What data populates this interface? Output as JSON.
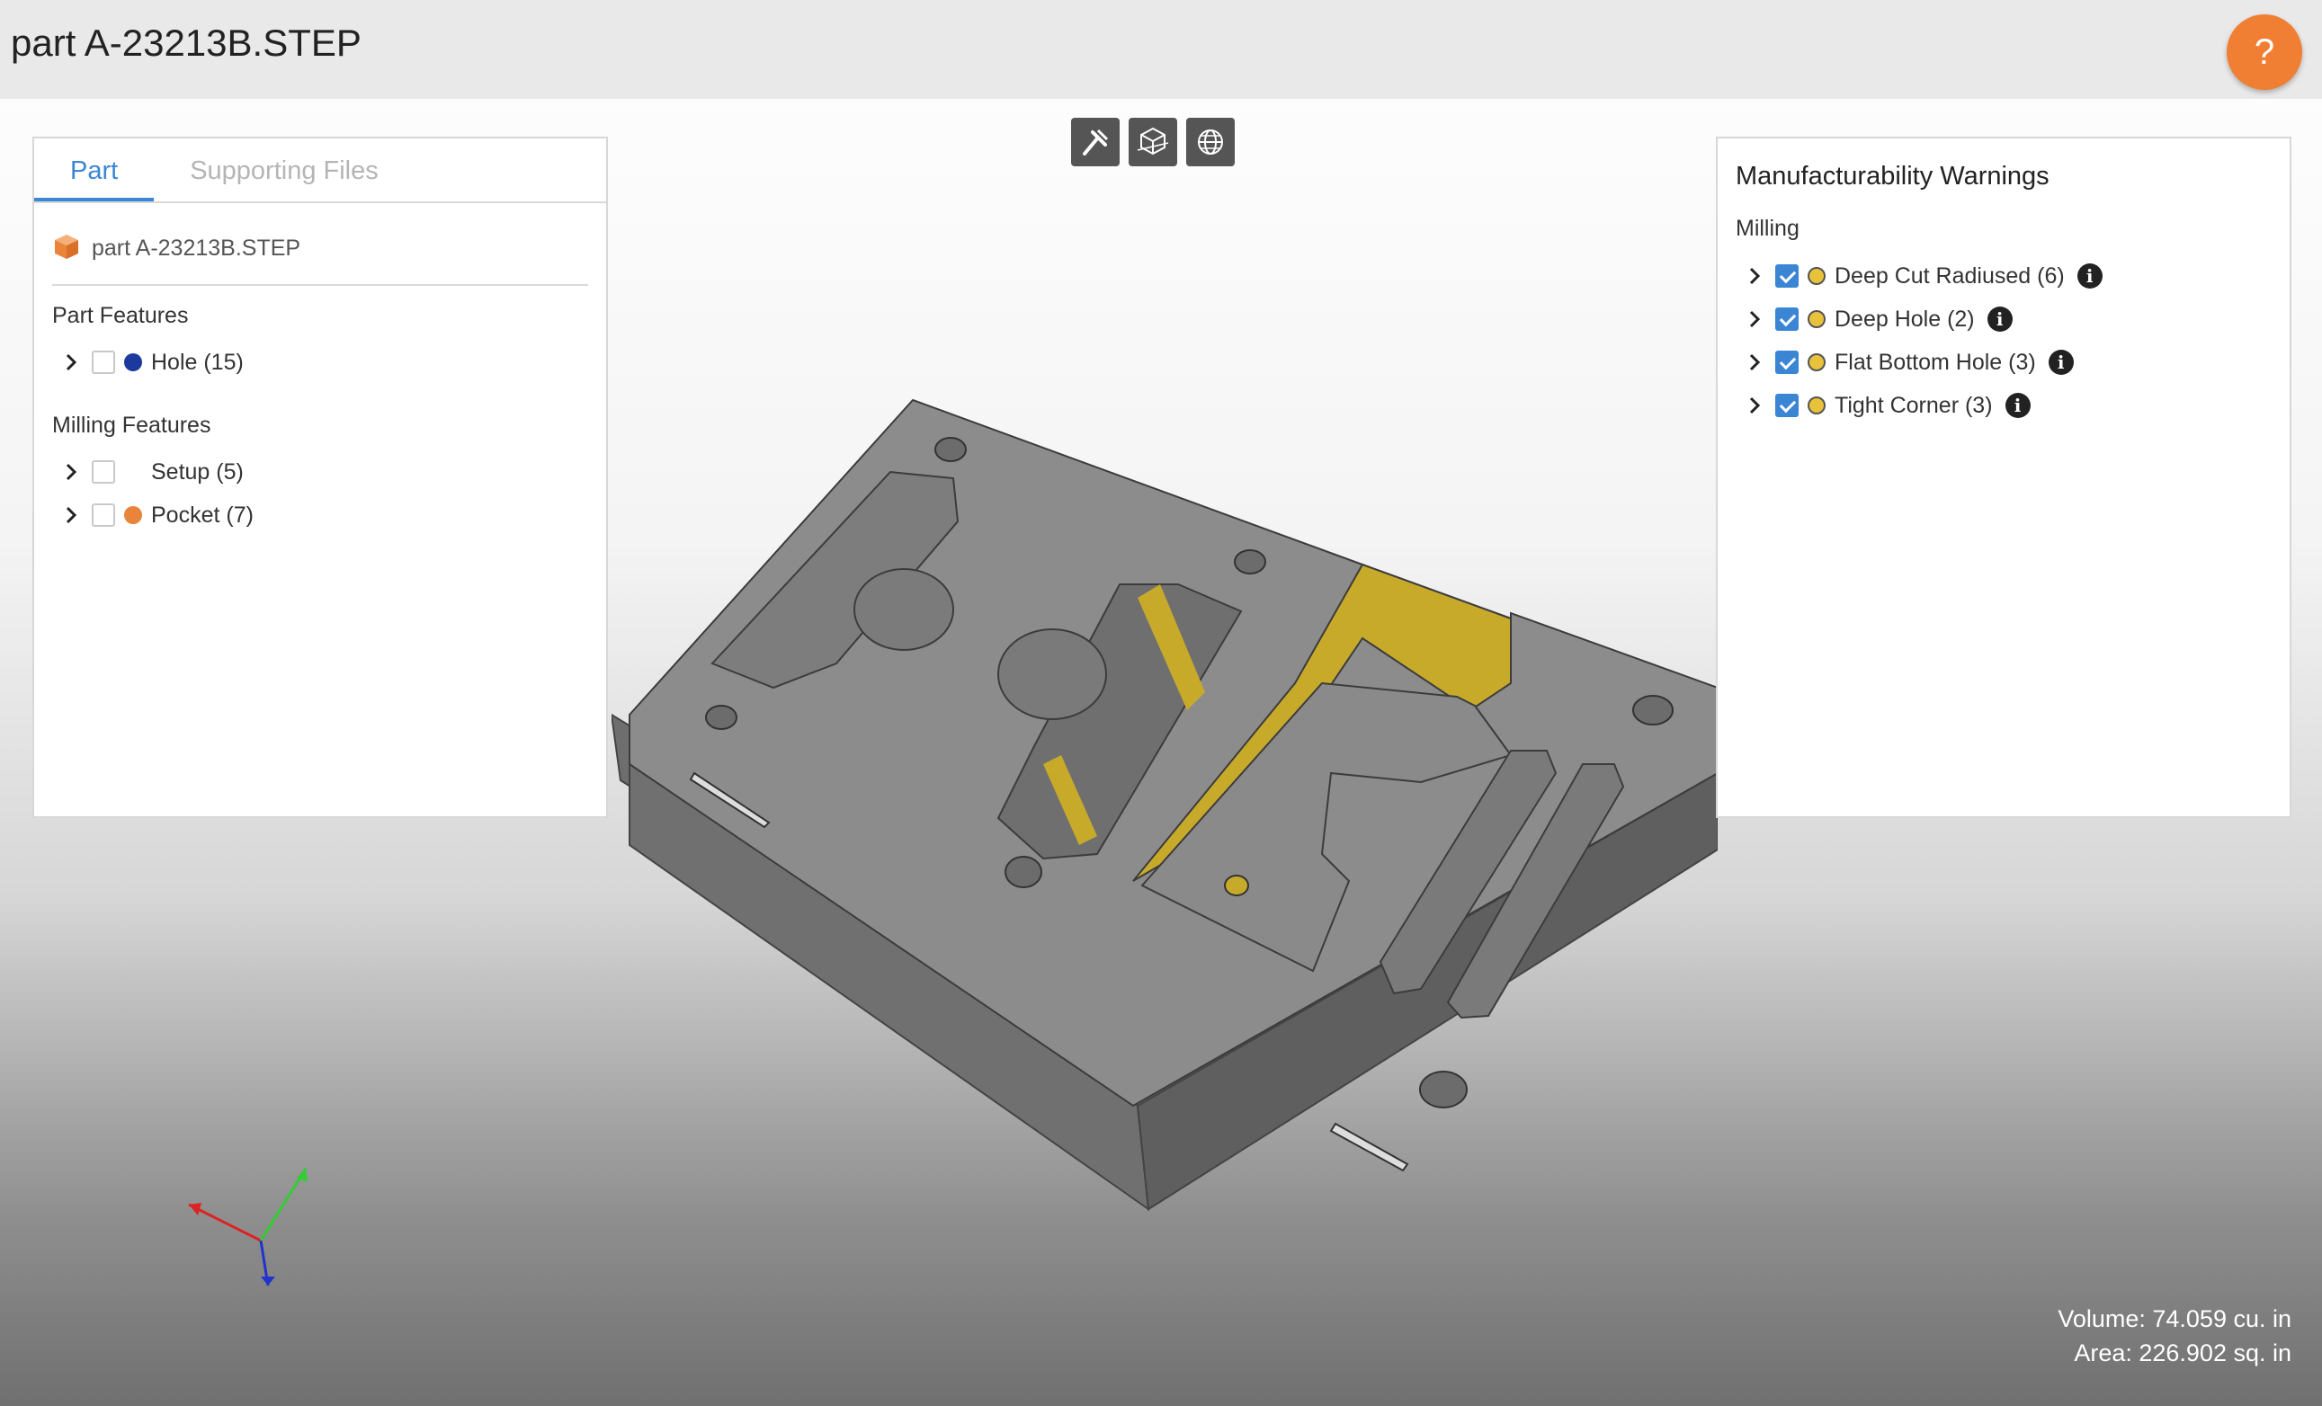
{
  "header": {
    "title": "part A-23213B.STEP",
    "help_label": "?"
  },
  "toolbar": {
    "buttons": [
      "measure-icon",
      "section-view-icon",
      "globe-icon"
    ]
  },
  "left_panel": {
    "tabs": [
      {
        "label": "Part",
        "active": true
      },
      {
        "label": "Supporting Files",
        "active": false
      }
    ],
    "file_name": "part A-23213B.STEP",
    "part_features": {
      "title": "Part Features",
      "items": [
        {
          "label": "Hole (15)",
          "checked": false,
          "color": "#1c3a9e"
        }
      ]
    },
    "milling_features": {
      "title": "Milling Features",
      "items": [
        {
          "label": "Setup (5)",
          "checked": false,
          "color": ""
        },
        {
          "label": "Pocket (7)",
          "checked": false,
          "color": "#e9843a"
        }
      ]
    }
  },
  "right_panel": {
    "title": "Manufacturability Warnings",
    "subtitle": "Milling",
    "items": [
      {
        "label": "Deep Cut Radiused (6)",
        "checked": true,
        "color": "#e8c23a"
      },
      {
        "label": "Deep Hole (2)",
        "checked": true,
        "color": "#e8c23a"
      },
      {
        "label": "Flat Bottom Hole (3)",
        "checked": true,
        "color": "#e8c23a"
      },
      {
        "label": "Tight Corner (3)",
        "checked": true,
        "color": "#e8c23a"
      }
    ]
  },
  "stats": {
    "volume": "Volume: 74.059 cu. in",
    "area": "Area: 226.902 sq. in"
  },
  "colors": {
    "accent": "#3a86d4",
    "help": "#f07f33",
    "part_gray": "#8c8c8c",
    "warning_yellow": "#c8aa2a"
  }
}
